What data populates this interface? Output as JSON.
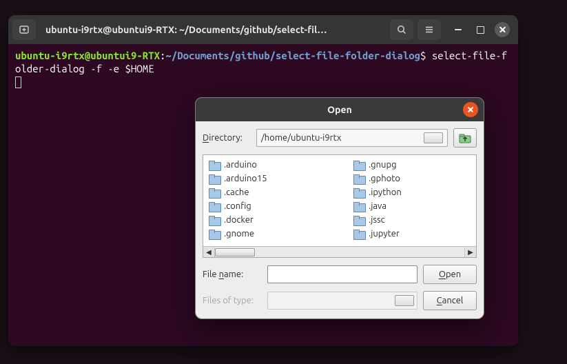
{
  "terminal": {
    "title": "ubuntu-i9rtx@ubuntui9-RTX: ~/Documents/github/select-fil…",
    "prompt_user": "ubuntu-i9rtx@ubuntui9-RTX",
    "prompt_sep": ":",
    "prompt_path": "~/Documents/github/select-file-folder-dialog",
    "prompt_dollar": "$",
    "command": "select-file-folder-dialog -f -e $HOME"
  },
  "dialog": {
    "title": "Open",
    "directory_label": "Directory:",
    "directory_label_ul": "D",
    "directory_label_rest": "irectory:",
    "directory_value": "/home/ubuntu-i9rtx",
    "filename_label_pre": "File ",
    "filename_label_ul": "n",
    "filename_label_post": "ame:",
    "filename_value": "",
    "filetypes_label": "Files of type:",
    "filetypes_value": "",
    "open_ul": "O",
    "open_rest": "pen",
    "cancel_ul": "C",
    "cancel_rest": "ancel",
    "folders": [
      ".arduino",
      ".arduino15",
      ".cache",
      ".config",
      ".docker",
      ".gnome",
      ".gnupg",
      ".gphoto",
      ".ipython",
      ".java",
      ".jssc",
      ".jupyter"
    ]
  }
}
